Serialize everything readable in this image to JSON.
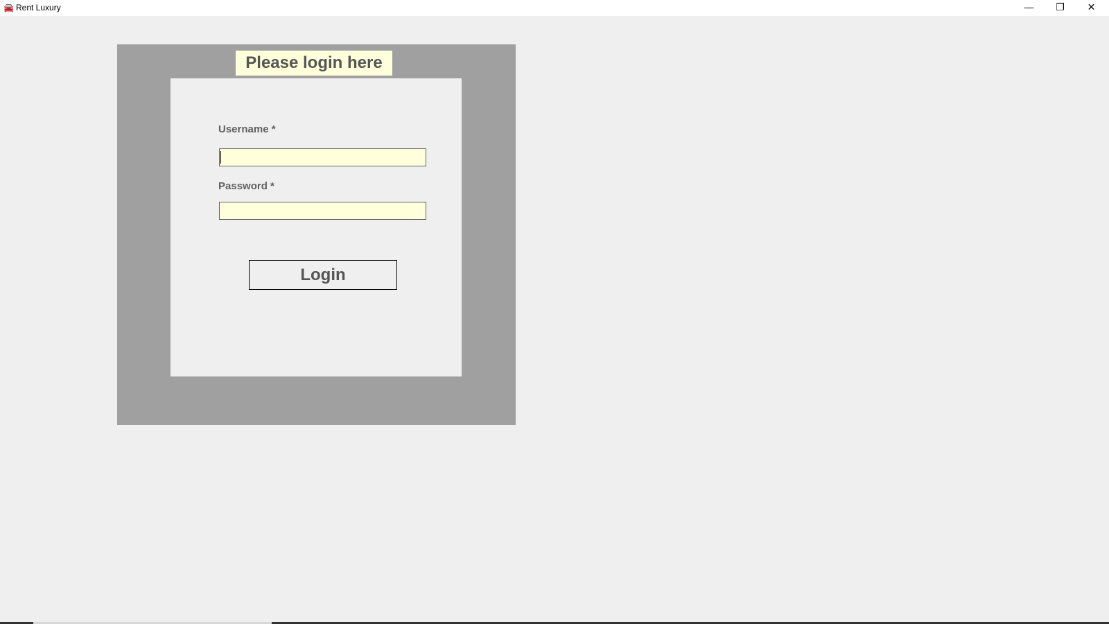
{
  "window": {
    "title": "Rent Luxury",
    "icon": "car-icon",
    "controls": {
      "minimize": "—",
      "restore": "❐",
      "close": "✕"
    }
  },
  "login": {
    "heading": "Please login here",
    "username_label": "Username *",
    "username_value": "",
    "password_label": "Password *",
    "password_value": "",
    "login_button": "Login"
  },
  "colors": {
    "panel": "#a0a0a0",
    "field_bg": "#ffffdc",
    "text": "#555555"
  }
}
